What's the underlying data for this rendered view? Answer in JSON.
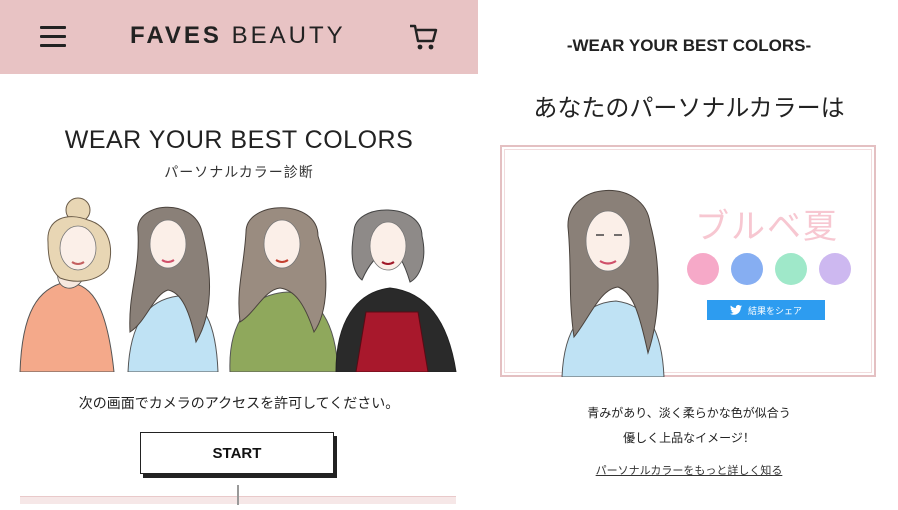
{
  "left_screen": {
    "brand": {
      "part1": "FAVES",
      "part2": "BEAUTY"
    },
    "hero_title": "WEAR YOUR BEST COLORS",
    "hero_subtitle": "パーソナルカラー診断",
    "instruction": "次の画面でカメラのアクセスを許可してください。",
    "start_label": "START",
    "header_color": "#e8c3c4",
    "icons": [
      "hamburger-menu-icon",
      "cart-icon"
    ]
  },
  "right_screen": {
    "tagline": "-WEAR YOUR BEST COLORS-",
    "heading": "あなたのパーソナルカラーは",
    "season": "ブルベ夏",
    "swatch_colors": [
      "#f6a9c8",
      "#86aef2",
      "#9fe8c9",
      "#cdb8f0"
    ],
    "share_label": "結果をシェア",
    "description_line1": "青みがあり、淡く柔らかな色が似合う",
    "description_line2": "優しく上品なイメージ！",
    "more_link": "パーソナルカラーをもっと詳しく知る",
    "card_border_color": "#e4c0c2",
    "icons": [
      "twitter-icon"
    ]
  }
}
